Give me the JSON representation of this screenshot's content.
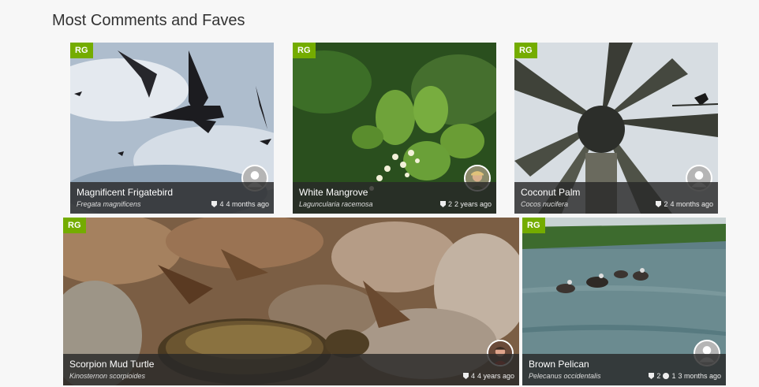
{
  "section": {
    "title": "Most Comments and Faves"
  },
  "cards": [
    {
      "badge": "RG",
      "common_name": "Magnificent Frigatebird",
      "scientific_name": "Fregata magnificens",
      "faves": "4",
      "comments": "",
      "age": "4 months ago",
      "avatar": "default",
      "photo_colors": [
        "#9fb3c8",
        "#dfe6ee",
        "#1e1e22"
      ]
    },
    {
      "badge": "RG",
      "common_name": "White Mangrove",
      "scientific_name": "Laguncularia racemosa",
      "faves": "2",
      "comments": "",
      "age": "2 years ago",
      "avatar": "user-photo",
      "photo_colors": [
        "#2f5d22",
        "#6fa33a",
        "#f2f0d8"
      ]
    },
    {
      "badge": "RG",
      "common_name": "Coconut Palm",
      "scientific_name": "Cocos nucifera",
      "faves": "2",
      "comments": "",
      "age": "4 months ago",
      "avatar": "default",
      "photo_colors": [
        "#d7dde2",
        "#5d6156",
        "#2c2e2a"
      ]
    },
    {
      "badge": "RG",
      "common_name": "Scorpion Mud Turtle",
      "scientific_name": "Kinosternon scorpioides",
      "faves": "4",
      "comments": "",
      "age": "4 years ago",
      "avatar": "user-photo",
      "photo_colors": [
        "#8a6a4c",
        "#b09a84",
        "#5a3a22"
      ]
    },
    {
      "badge": "RG",
      "common_name": "Brown Pelican",
      "scientific_name": "Pelecanus occidentalis",
      "faves": "2",
      "comments": "1",
      "age": "3 months ago",
      "avatar": "default",
      "photo_colors": [
        "#5f7f86",
        "#3d6b2e",
        "#c9d3d4"
      ]
    }
  ],
  "colors": {
    "rg_badge": "#74ac00",
    "caption_bg": "#282828",
    "page_bg": "#f7f7f7"
  }
}
